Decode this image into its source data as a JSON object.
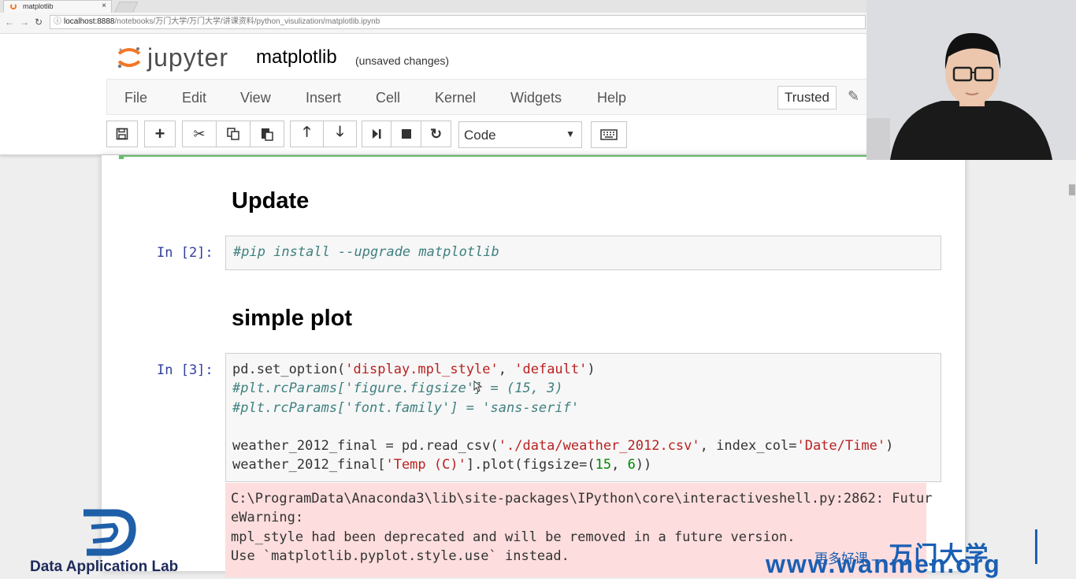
{
  "browser": {
    "tab_title": "matplotlib",
    "tab_close": "×",
    "url_host": "localhost:8888",
    "url_path": "/notebooks/万门大学/万门大学/讲课资料/python_visulization/matplotlib.ipynb"
  },
  "jupyter": {
    "logo_text": "jupyter",
    "notebook_title": "matplotlib",
    "save_status": "(unsaved changes)",
    "menu": [
      "File",
      "Edit",
      "View",
      "Insert",
      "Cell",
      "Kernel",
      "Widgets",
      "Help"
    ],
    "trusted_label": "Trusted",
    "cell_type": "Code"
  },
  "toolbar_icons": [
    "save-icon",
    "plus-icon",
    "cut-icon",
    "copy-icon",
    "paste-icon",
    "arrow-up-icon",
    "arrow-down-icon",
    "step-forward-icon",
    "stop-icon",
    "refresh-icon",
    "keyboard-icon"
  ],
  "cells": {
    "heading_update": "Update",
    "cell2_prompt": "In  [2]:",
    "cell2_code": "#pip install --upgrade matplotlib",
    "heading_simple": "simple plot",
    "cell3_prompt": "In  [3]:",
    "cell3_lines": [
      [
        {
          "t": "pd.set_option(",
          "c": ""
        },
        {
          "t": "'display.mpl_style'",
          "c": "str"
        },
        {
          "t": ", ",
          "c": ""
        },
        {
          "t": "'default'",
          "c": "str"
        },
        {
          "t": ")",
          "c": ""
        }
      ],
      [
        {
          "t": "#plt.rcParams['figure.figsize'] = (15, 3)",
          "c": "cm"
        }
      ],
      [
        {
          "t": "#plt.rcParams['font.family'] = 'sans-serif'",
          "c": "cm"
        }
      ],
      [
        {
          "t": "",
          "c": ""
        }
      ],
      [
        {
          "t": "weather_2012_final = pd.read_csv(",
          "c": ""
        },
        {
          "t": "'./data/weather_2012.csv'",
          "c": "str"
        },
        {
          "t": ", index_col=",
          "c": ""
        },
        {
          "t": "'Date/Time'",
          "c": "str"
        },
        {
          "t": ")",
          "c": ""
        }
      ],
      [
        {
          "t": "weather_2012_final[",
          "c": ""
        },
        {
          "t": "'Temp (C)'",
          "c": "str"
        },
        {
          "t": "].plot(figsize=(",
          "c": ""
        },
        {
          "t": "15",
          "c": "num"
        },
        {
          "t": ", ",
          "c": ""
        },
        {
          "t": "6",
          "c": "num"
        },
        {
          "t": "))",
          "c": ""
        }
      ]
    ],
    "stderr_lines": [
      "C:\\ProgramData\\Anaconda3\\lib\\site-packages\\IPython\\core\\interactiveshell.py:2862: Futur",
      "eWarning:",
      "mpl_style had been deprecated and will be removed in a future version.",
      "Use `matplotlib.pyplot.style.use` instead."
    ]
  },
  "watermarks": {
    "dal_text": "Data Application Lab",
    "slogan_small": "更多好课 —",
    "slogan_big": "万门大学",
    "url": "www.wanmen.org"
  }
}
